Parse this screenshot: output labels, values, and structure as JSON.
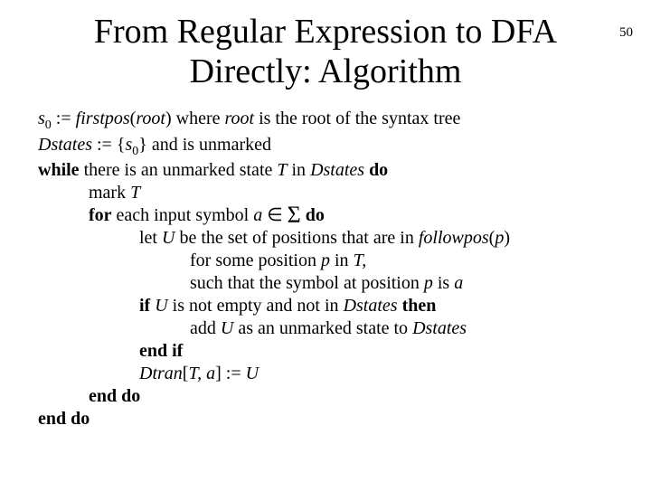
{
  "page_number": "50",
  "title": "From Regular Expression to DFA Directly: Algorithm",
  "s": "s",
  "zero": "0",
  "assign": " := ",
  "firstpos": "firstpos",
  "lparen": "(",
  "root": "root",
  "rparen": ")",
  "where_root_phrase": " where ",
  "is_root_phrase": " is the root of the syntax tree",
  "dstates": "Dstates",
  "assign_set_open": " := {",
  "set_close_unmarked": "} and is unmarked",
  "while": "while",
  "while_phrase": " there is an unmarked state ",
  "T": "T",
  "in_word": " in ",
  "do": "do",
  "mark": "mark ",
  "for": "for",
  "each_input": " each input symbol ",
  "a": "a",
  "elem": " ∈ ",
  "Sigma": "Σ",
  "sp_do": " ",
  "let": "let ",
  "U": "U",
  "be_set": " be the set of positions that are in ",
  "followpos": "followpos",
  "p": "p",
  "for_some_pos": "for some position ",
  "comma": ",",
  "such_that": "such that the symbol at position ",
  "is_a": " is ",
  "if": "if",
  "not_empty": " is not empty and not in ",
  "then": "then",
  "add": "add ",
  "as_unmarked": " as an unmarked state to ",
  "endif": "end if",
  "Dtran": "Dtran",
  "lbrack": "[",
  "comma_sp": ", ",
  "rbrack_assign": "] := ",
  "enddo": "end do"
}
